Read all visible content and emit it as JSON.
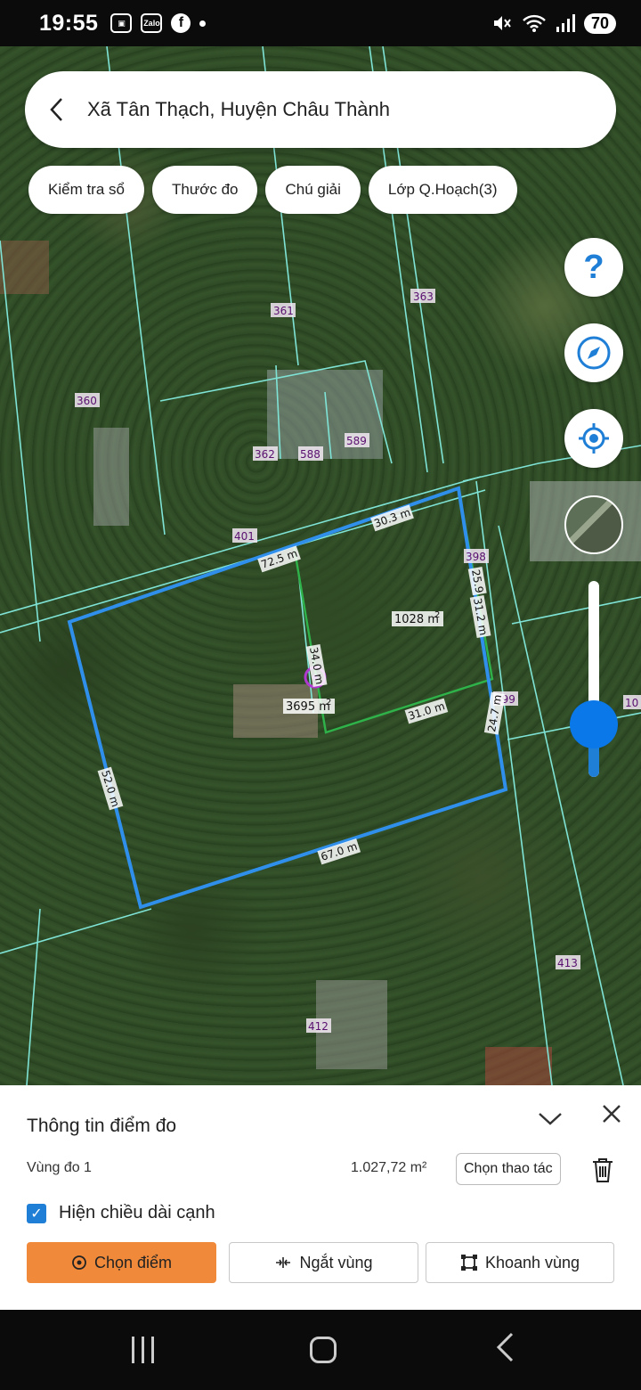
{
  "status_bar": {
    "time": "19:55",
    "app_icon_label": "Zalo",
    "battery": "70"
  },
  "topbar": {
    "title": "Xã Tân Thạch, Huyện Châu Thành"
  },
  "chips": [
    {
      "label": "Kiểm tra sổ"
    },
    {
      "label": "Thước đo"
    },
    {
      "label": "Chú giải"
    },
    {
      "label": "Lớp Q.Hoạch(3)"
    }
  ],
  "map": {
    "parcels": [
      "361",
      "363",
      "360",
      "362",
      "588",
      "589",
      "401",
      "398",
      "399",
      "413",
      "412",
      "10"
    ],
    "measurements": [
      "30.3 m",
      "72.5 m",
      "25.9",
      "31.2 m",
      "34.0 m",
      "31.0 m",
      "24.7 m",
      "52.0 m",
      "67.0 m"
    ],
    "areas": [
      "1028 m",
      "3695 m"
    ],
    "area_unit_sup": "2",
    "colors": {
      "blue_outline": "#2f8fea",
      "green_outline": "#2fb24a",
      "parcel_line": "#7fe3d6",
      "marker": "#b03ad0"
    }
  },
  "fabs": {
    "help": "?",
    "icons": [
      "help-icon",
      "compass-icon",
      "locate-icon",
      "layer-thumbnail"
    ]
  },
  "zoom_slider": {
    "level": 0.7
  },
  "sheet": {
    "title": "Thông tin điểm đo",
    "zone_label": "Vùng đo 1",
    "zone_area": "1.027,72 m²",
    "zone_action": "Chọn thao tác",
    "checkbox_label": "Hiện chiều dài cạnh",
    "checkbox_checked": true,
    "buttons": {
      "pick_point": "Chọn điểm",
      "split_zone": "Ngắt vùng",
      "draw_zone": "Khoanh vùng"
    },
    "accent": "#f08a3a"
  }
}
